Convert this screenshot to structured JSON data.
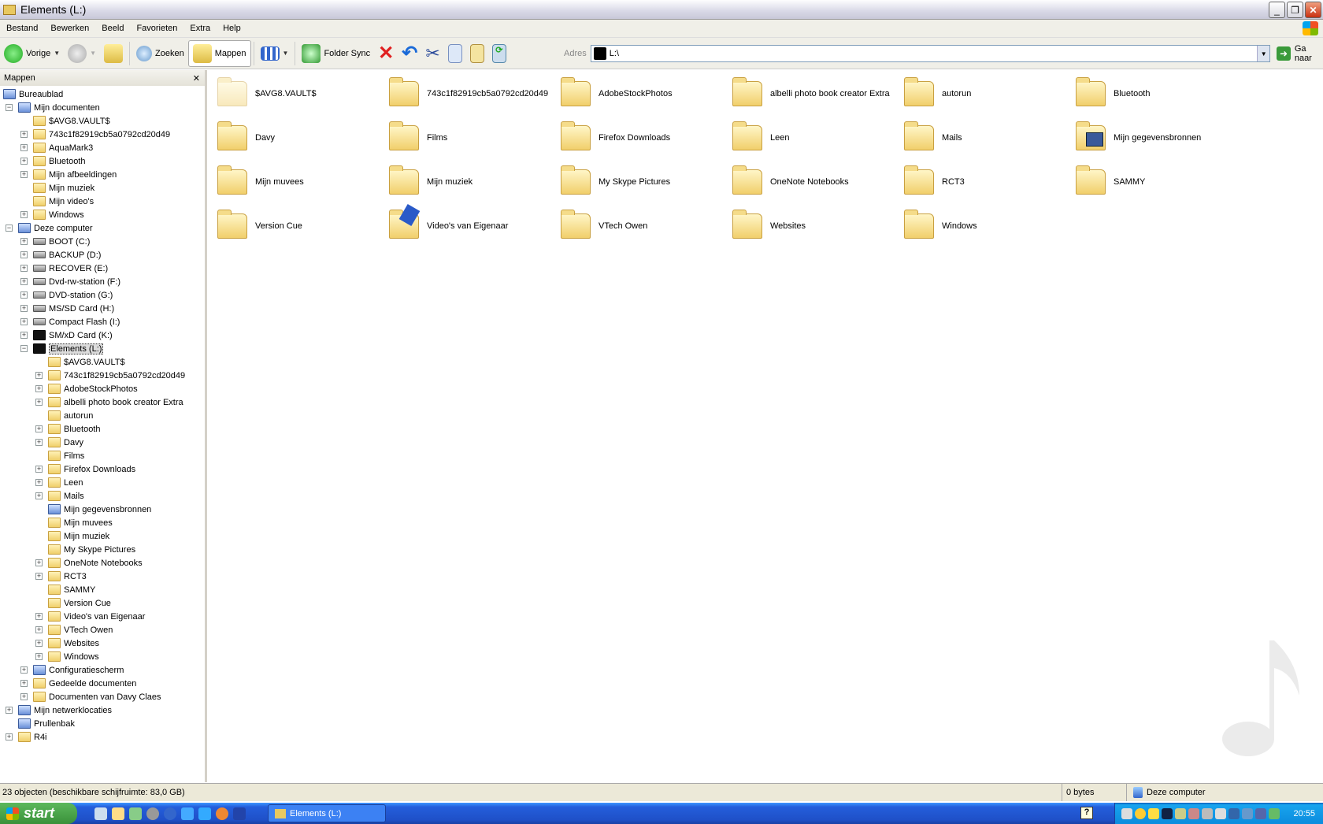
{
  "window": {
    "title": "Elements (L:)"
  },
  "menu": [
    "Bestand",
    "Bewerken",
    "Beeld",
    "Favorieten",
    "Extra",
    "Help"
  ],
  "toolbar": {
    "back": "Vorige",
    "search": "Zoeken",
    "folders": "Mappen",
    "folder_sync": "Folder Sync"
  },
  "address": {
    "label": "Adres",
    "value": "L:\\",
    "go": "Ga naar"
  },
  "left_pane": {
    "title": "Mappen",
    "close": "✕"
  },
  "tree": [
    {
      "l": 0,
      "e": "",
      "label": "Bureaublad",
      "i": "special"
    },
    {
      "l": 1,
      "e": "-",
      "label": "Mijn documenten",
      "i": "special"
    },
    {
      "l": 2,
      "e": "",
      "label": "$AVG8.VAULT$",
      "i": "folder"
    },
    {
      "l": 2,
      "e": "+",
      "label": "743c1f82919cb5a0792cd20d49",
      "i": "folder"
    },
    {
      "l": 2,
      "e": "+",
      "label": "AquaMark3",
      "i": "folder"
    },
    {
      "l": 2,
      "e": "+",
      "label": "Bluetooth",
      "i": "folder"
    },
    {
      "l": 2,
      "e": "+",
      "label": "Mijn afbeeldingen",
      "i": "folder"
    },
    {
      "l": 2,
      "e": "",
      "label": "Mijn muziek",
      "i": "folder"
    },
    {
      "l": 2,
      "e": "",
      "label": "Mijn video's",
      "i": "folder"
    },
    {
      "l": 2,
      "e": "+",
      "label": "Windows",
      "i": "folder"
    },
    {
      "l": 1,
      "e": "-",
      "label": "Deze computer",
      "i": "special"
    },
    {
      "l": 2,
      "e": "+",
      "label": "BOOT (C:)",
      "i": "drive"
    },
    {
      "l": 2,
      "e": "+",
      "label": "BACKUP (D:)",
      "i": "drive"
    },
    {
      "l": 2,
      "e": "+",
      "label": "RECOVER (E:)",
      "i": "drive"
    },
    {
      "l": 2,
      "e": "+",
      "label": "Dvd-rw-station (F:)",
      "i": "drive"
    },
    {
      "l": 2,
      "e": "+",
      "label": "DVD-station (G:)",
      "i": "drive"
    },
    {
      "l": 2,
      "e": "+",
      "label": "MS/SD Card (H:)",
      "i": "drive"
    },
    {
      "l": 2,
      "e": "+",
      "label": "Compact Flash (I:)",
      "i": "drive"
    },
    {
      "l": 2,
      "e": "+",
      "label": "SM/xD Card (K:)",
      "i": "blackdrv"
    },
    {
      "l": 2,
      "e": "-",
      "label": "Elements (L:)",
      "i": "blackdrv",
      "sel": true
    },
    {
      "l": 3,
      "e": "",
      "label": "$AVG8.VAULT$",
      "i": "folder"
    },
    {
      "l": 3,
      "e": "+",
      "label": "743c1f82919cb5a0792cd20d49",
      "i": "folder"
    },
    {
      "l": 3,
      "e": "+",
      "label": "AdobeStockPhotos",
      "i": "folder"
    },
    {
      "l": 3,
      "e": "+",
      "label": "albelli photo book creator Extra",
      "i": "folder"
    },
    {
      "l": 3,
      "e": "",
      "label": "autorun",
      "i": "folder"
    },
    {
      "l": 3,
      "e": "+",
      "label": "Bluetooth",
      "i": "folder"
    },
    {
      "l": 3,
      "e": "+",
      "label": "Davy",
      "i": "folder"
    },
    {
      "l": 3,
      "e": "",
      "label": "Films",
      "i": "folder"
    },
    {
      "l": 3,
      "e": "+",
      "label": "Firefox Downloads",
      "i": "folder"
    },
    {
      "l": 3,
      "e": "+",
      "label": "Leen",
      "i": "folder"
    },
    {
      "l": 3,
      "e": "+",
      "label": "Mails",
      "i": "folder"
    },
    {
      "l": 3,
      "e": "",
      "label": "Mijn gegevensbronnen",
      "i": "special"
    },
    {
      "l": 3,
      "e": "",
      "label": "Mijn muvees",
      "i": "folder"
    },
    {
      "l": 3,
      "e": "",
      "label": "Mijn muziek",
      "i": "folder"
    },
    {
      "l": 3,
      "e": "",
      "label": "My Skype Pictures",
      "i": "folder"
    },
    {
      "l": 3,
      "e": "+",
      "label": "OneNote Notebooks",
      "i": "folder"
    },
    {
      "l": 3,
      "e": "+",
      "label": "RCT3",
      "i": "folder"
    },
    {
      "l": 3,
      "e": "",
      "label": "SAMMY",
      "i": "folder"
    },
    {
      "l": 3,
      "e": "",
      "label": "Version Cue",
      "i": "folder"
    },
    {
      "l": 3,
      "e": "+",
      "label": "Video's van Eigenaar",
      "i": "folder"
    },
    {
      "l": 3,
      "e": "+",
      "label": "VTech Owen",
      "i": "folder"
    },
    {
      "l": 3,
      "e": "+",
      "label": "Websites",
      "i": "folder"
    },
    {
      "l": 3,
      "e": "+",
      "label": "Windows",
      "i": "folder"
    },
    {
      "l": 2,
      "e": "+",
      "label": "Configuratiescherm",
      "i": "special"
    },
    {
      "l": 2,
      "e": "+",
      "label": "Gedeelde documenten",
      "i": "folder"
    },
    {
      "l": 2,
      "e": "+",
      "label": "Documenten van Davy Claes",
      "i": "folder"
    },
    {
      "l": 1,
      "e": "+",
      "label": "Mijn netwerklocaties",
      "i": "special"
    },
    {
      "l": 1,
      "e": "",
      "label": "Prullenbak",
      "i": "special"
    },
    {
      "l": 1,
      "e": "+",
      "label": "R4i",
      "i": "folder"
    }
  ],
  "items": [
    {
      "label": "$AVG8.VAULT$",
      "t": "ghost"
    },
    {
      "label": "743c1f82919cb5a0792cd20d49",
      "t": ""
    },
    {
      "label": "AdobeStockPhotos",
      "t": ""
    },
    {
      "label": "albelli photo book creator Extra",
      "t": ""
    },
    {
      "label": "autorun",
      "t": ""
    },
    {
      "label": "Bluetooth",
      "t": ""
    },
    {
      "label": "Davy",
      "t": ""
    },
    {
      "label": "Films",
      "t": ""
    },
    {
      "label": "Firefox Downloads",
      "t": ""
    },
    {
      "label": "Leen",
      "t": ""
    },
    {
      "label": "Mails",
      "t": ""
    },
    {
      "label": "Mijn gegevensbronnen",
      "t": "data"
    },
    {
      "label": "Mijn muvees",
      "t": ""
    },
    {
      "label": "Mijn muziek",
      "t": ""
    },
    {
      "label": "My Skype Pictures",
      "t": ""
    },
    {
      "label": "OneNote Notebooks",
      "t": ""
    },
    {
      "label": "RCT3",
      "t": ""
    },
    {
      "label": "SAMMY",
      "t": ""
    },
    {
      "label": "Version Cue",
      "t": ""
    },
    {
      "label": "Video's van Eigenaar",
      "t": "video"
    },
    {
      "label": "VTech Owen",
      "t": ""
    },
    {
      "label": "Websites",
      "t": ""
    },
    {
      "label": "Windows",
      "t": ""
    }
  ],
  "status": {
    "objects": "23 objecten (beschikbare schijfruimte: 83,0 GB)",
    "size": "0 bytes",
    "zone": "Deze computer"
  },
  "taskbar": {
    "start": "start",
    "task": "Elements (L:)",
    "clock": "20:55",
    "help": "?"
  }
}
